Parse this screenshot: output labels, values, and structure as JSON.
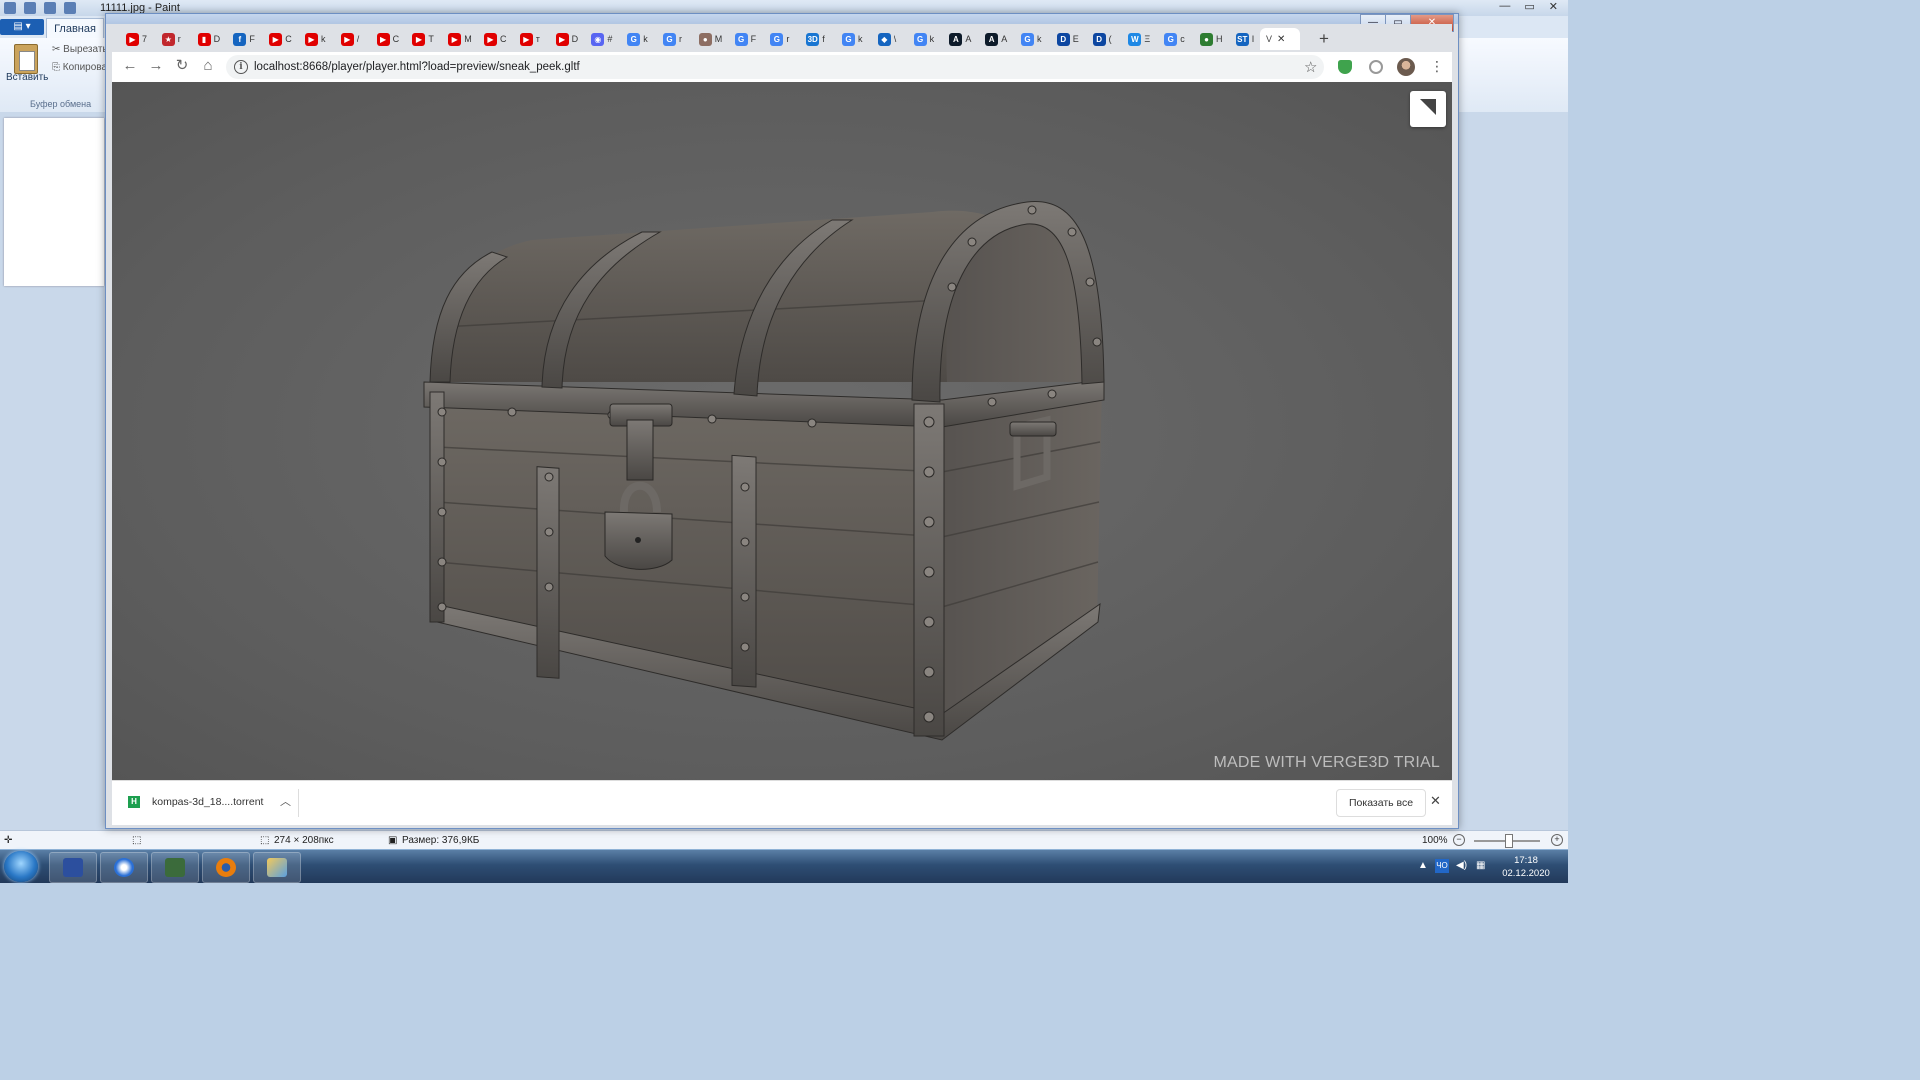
{
  "paint": {
    "title": "11111.jpg - Paint",
    "file_tab": "▤ ▾",
    "home_tab": "Главная",
    "paste_label": "Вставить",
    "cut_label": "Вырезать",
    "copy_label": "Копировать",
    "clipboard_group": "Буфер обмена",
    "status_dims": "274 × 208пкс",
    "status_size": "Размер: 376,9КБ",
    "zoom": "100%",
    "window_controls": [
      "—",
      "▭",
      "✕"
    ]
  },
  "browser": {
    "tabs": [
      {
        "fav_color": "#e00000",
        "fav": "▶",
        "t": "7"
      },
      {
        "fav_color": "#c1272d",
        "fav": "★",
        "t": "r"
      },
      {
        "fav_color": "#e00000",
        "fav": "▮",
        "t": "D"
      },
      {
        "fav_color": "#1565c0",
        "fav": "f",
        "t": "F"
      },
      {
        "fav_color": "#e00000",
        "fav": "▶",
        "t": "C"
      },
      {
        "fav_color": "#e00000",
        "fav": "▶",
        "t": "k"
      },
      {
        "fav_color": "#e00000",
        "fav": "▶",
        "t": "/"
      },
      {
        "fav_color": "#e00000",
        "fav": "▶",
        "t": "C"
      },
      {
        "fav_color": "#e00000",
        "fav": "▶",
        "t": "T"
      },
      {
        "fav_color": "#e00000",
        "fav": "▶",
        "t": "M"
      },
      {
        "fav_color": "#e00000",
        "fav": "▶",
        "t": "C"
      },
      {
        "fav_color": "#e00000",
        "fav": "▶",
        "t": "т"
      },
      {
        "fav_color": "#e00000",
        "fav": "▶",
        "t": "D"
      },
      {
        "fav_color": "#5865f2",
        "fav": "◉",
        "t": "#"
      },
      {
        "fav_color": "#4285f4",
        "fav": "G",
        "t": "k"
      },
      {
        "fav_color": "#4285f4",
        "fav": "G",
        "t": "r"
      },
      {
        "fav_color": "#8d6e63",
        "fav": "●",
        "t": "M"
      },
      {
        "fav_color": "#4285f4",
        "fav": "G",
        "t": "F"
      },
      {
        "fav_color": "#4285f4",
        "fav": "G",
        "t": "r"
      },
      {
        "fav_color": "#1976d2",
        "fav": "3D",
        "t": "f"
      },
      {
        "fav_color": "#4285f4",
        "fav": "G",
        "t": "k"
      },
      {
        "fav_color": "#1565c0",
        "fav": "◆",
        "t": "\\"
      },
      {
        "fav_color": "#4285f4",
        "fav": "G",
        "t": "k"
      },
      {
        "fav_color": "#0d1b2a",
        "fav": "A",
        "t": "A"
      },
      {
        "fav_color": "#0d1b2a",
        "fav": "A",
        "t": "A"
      },
      {
        "fav_color": "#4285f4",
        "fav": "G",
        "t": "k"
      },
      {
        "fav_color": "#0d47a1",
        "fav": "D",
        "t": "E"
      },
      {
        "fav_color": "#0d47a1",
        "fav": "D",
        "t": "("
      },
      {
        "fav_color": "#1e88e5",
        "fav": "W",
        "t": "Ξ"
      },
      {
        "fav_color": "#4285f4",
        "fav": "G",
        "t": "c"
      },
      {
        "fav_color": "#2e7d32",
        "fav": "●",
        "t": "H"
      },
      {
        "fav_color": "#1565c0",
        "fav": "ST",
        "t": "I"
      }
    ],
    "active_tab": {
      "fav": "V",
      "close": "✕"
    },
    "new_tab": "+",
    "url": "localhost:8668/player/player.html?load=preview/sneak_peek.gltf",
    "watermark": "MADE WITH VERGE3D TRIAL",
    "download": {
      "name": "kompas-3d_18....torrent",
      "icon": "H"
    },
    "show_all": "Показать все",
    "window_controls": [
      "—",
      "▭",
      "✕"
    ]
  },
  "taskbar": {
    "apps": [
      "save-disk-app",
      "browser-app",
      "monitor-app",
      "blender-app",
      "paint-app"
    ],
    "lang": "ЧО",
    "time": "17:18",
    "date": "02.12.2020"
  }
}
